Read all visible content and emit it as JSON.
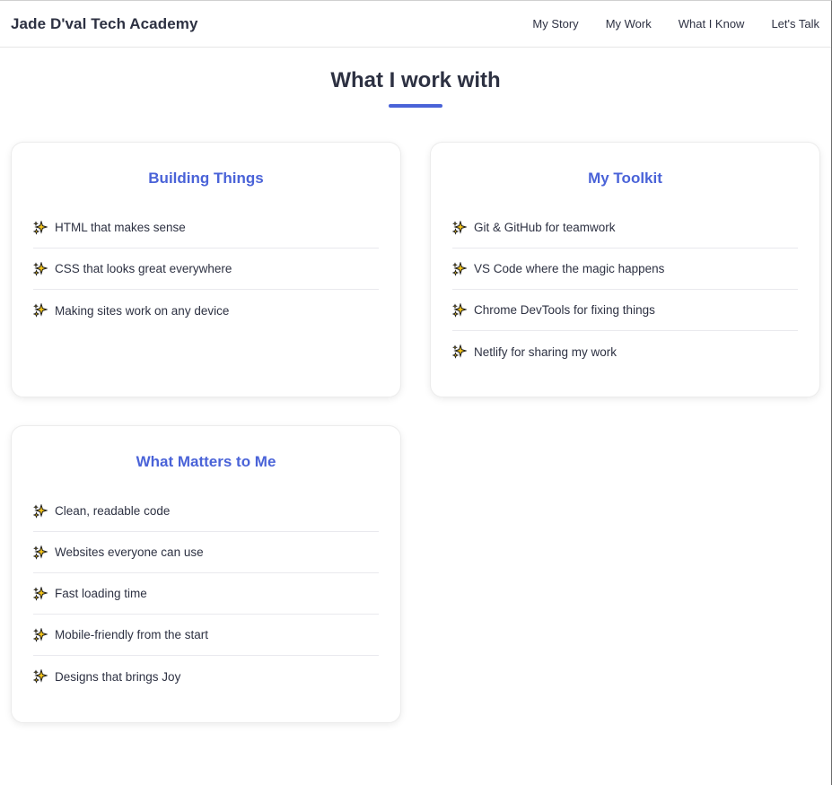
{
  "header": {
    "brand": "Jade D'val Tech Academy",
    "nav": [
      "My Story",
      "My Work",
      "What I Know",
      "Let's Talk"
    ]
  },
  "section": {
    "title": "What I work with",
    "accent_color": "#4a63d8"
  },
  "cards": [
    {
      "title": "Building Things",
      "items": [
        "HTML that makes sense",
        "CSS that looks great everywhere",
        "Making sites work on any device"
      ]
    },
    {
      "title": "My Toolkit",
      "items": [
        "Git & GitHub for teamwork",
        "VS Code where the magic happens",
        "Chrome DevTools for fixing things",
        "Netlify for sharing my work"
      ]
    },
    {
      "title": "What Matters to Me",
      "items": [
        "Clean, readable code",
        "Websites everyone can use",
        "Fast loading time",
        "Mobile-friendly from the start",
        "Designs that brings Joy"
      ]
    }
  ],
  "icons": {
    "list_bullet": "sparkles-icon"
  }
}
